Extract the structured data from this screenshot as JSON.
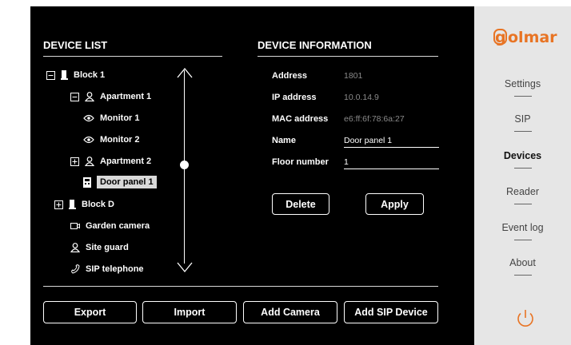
{
  "device_list": {
    "header": "DEVICE LIST",
    "items": [
      {
        "label": "Block 1",
        "level": 0,
        "icon": "building-icon",
        "expander": "minus"
      },
      {
        "label": "Apartment 1",
        "level": 1,
        "icon": "person-icon",
        "expander": "minus"
      },
      {
        "label": "Monitor 1",
        "level": 2,
        "icon": "eye-icon",
        "expander": ""
      },
      {
        "label": "Monitor 2",
        "level": 2,
        "icon": "eye-icon",
        "expander": ""
      },
      {
        "label": "Apartment 2",
        "level": 1,
        "icon": "person-icon",
        "expander": "plus"
      },
      {
        "label": "Door panel 1",
        "level": 2,
        "icon": "door-panel-icon",
        "expander": "",
        "selected": true
      },
      {
        "label": "Block D",
        "level": 0,
        "icon": "building-icon",
        "expander": "plus"
      },
      {
        "label": "Garden camera",
        "level": 0,
        "icon": "camera-icon",
        "expander": ""
      },
      {
        "label": "Site guard",
        "level": 0,
        "icon": "person-icon",
        "expander": ""
      },
      {
        "label": "SIP telephone",
        "level": 0,
        "icon": "phone-icon",
        "expander": ""
      }
    ]
  },
  "device_info": {
    "header": "DEVICE INFORMATION",
    "address_label": "Address",
    "address_value": "1801",
    "ip_label": "IP address",
    "ip_value": "10.0.14.9",
    "mac_label": "MAC address",
    "mac_value": "e6:ff:6f:78:6a:27",
    "name_label": "Name",
    "name_value": "Door panel 1",
    "floor_label": "Floor number",
    "floor_value": "1",
    "delete_label": "Delete",
    "apply_label": "Apply"
  },
  "footer": {
    "export_label": "Export",
    "import_label": "Import",
    "add_camera_label": "Add Camera",
    "add_sip_label": "Add SIP Device"
  },
  "sidebar": {
    "brand": "olmar",
    "brand_initial": "g",
    "brand_color": "#e87424",
    "items": [
      {
        "label": "Settings"
      },
      {
        "label": "SIP"
      },
      {
        "label": "Devices",
        "active": true
      },
      {
        "label": "Reader"
      },
      {
        "label": "Event log"
      },
      {
        "label": "About"
      }
    ],
    "power_icon": "power-icon"
  }
}
